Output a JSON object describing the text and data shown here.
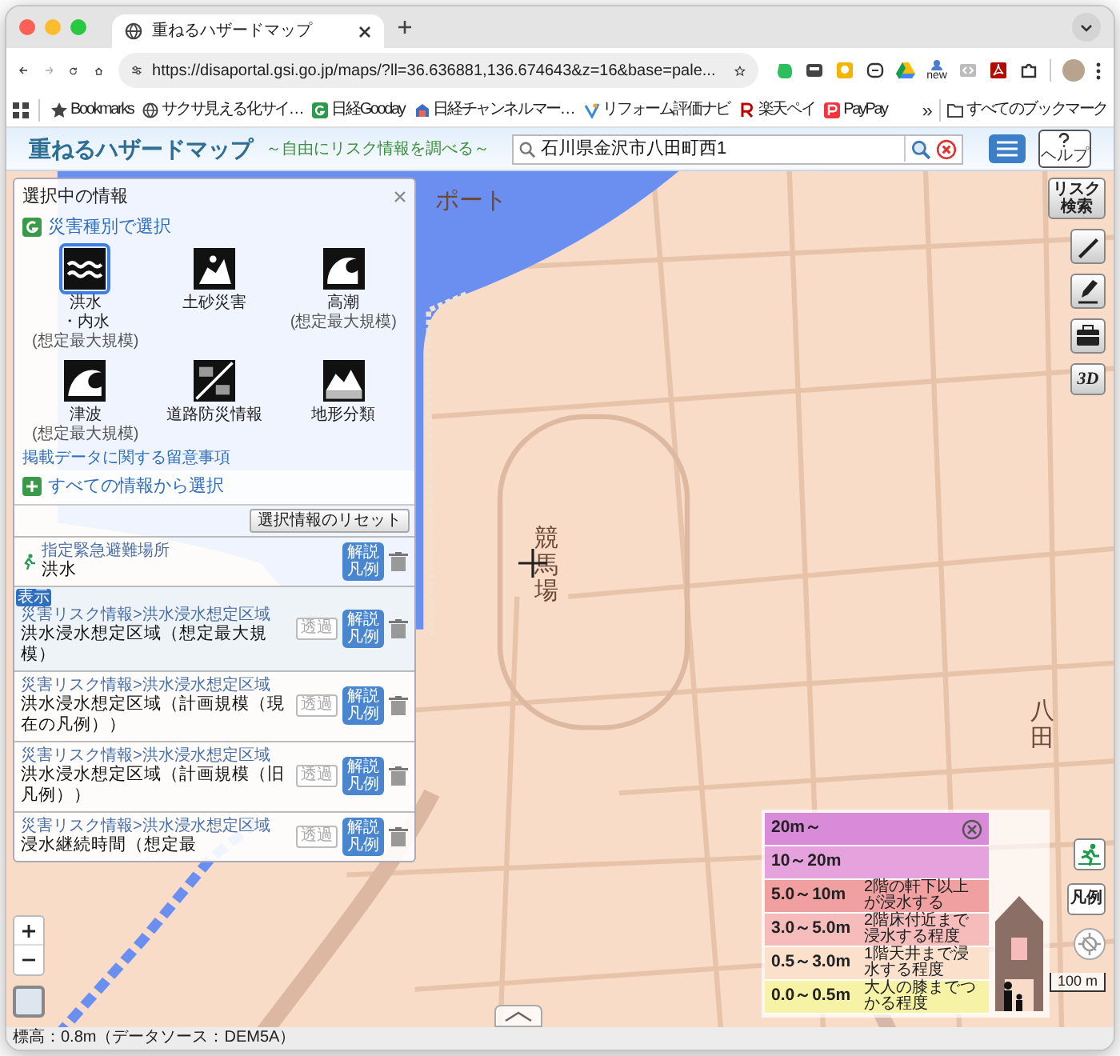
{
  "browser": {
    "tab": {
      "title": "重ねるハザードマップ"
    },
    "url": "https://disaportal.gsi.go.jp/maps/?ll=36.636881,136.674643&z=16&base=pale...",
    "extension_badge": "new",
    "bookmarks": [
      {
        "kind": "star",
        "label": "Bookmarks"
      },
      {
        "kind": "globe",
        "label": "サクサ見える化サイ…"
      },
      {
        "kind": "gooday",
        "label": "日経Gooday"
      },
      {
        "kind": "channel",
        "label": "日経チャンネルマー…"
      },
      {
        "kind": "reform",
        "label": "リフォーム評価ナビ"
      },
      {
        "kind": "rakuten",
        "label": "楽天ペイ"
      },
      {
        "kind": "paypay",
        "label": "PayPay"
      }
    ],
    "bookmarks_overflow": "»",
    "all_bookmarks": "すべてのブックマーク"
  },
  "app": {
    "title": "重ねるハザードマップ",
    "subtitle": "～自由にリスク情報を調べる～",
    "search": {
      "value": "石川県金沢市八田町西1"
    },
    "help": "ヘルプ"
  },
  "panel": {
    "title": "選択中の情報",
    "by_disaster": "災害種別で選択",
    "hazards": [
      {
        "kind": "flood",
        "label": "洪水",
        "label_2": "・内水",
        "note": "(想定最大規模)",
        "selected": true
      },
      {
        "kind": "landslide",
        "label": "土砂災害",
        "selected": false
      },
      {
        "kind": "surge",
        "label": "高潮",
        "note": "(想定最大規模)",
        "selected": false
      },
      {
        "kind": "tsunami",
        "label": "津波",
        "note": "(想定最大規模)",
        "selected": false
      },
      {
        "kind": "road",
        "label": "道路防災情報",
        "selected": false
      },
      {
        "kind": "terrain",
        "label": "地形分類",
        "selected": false
      }
    ],
    "notice_link": "掲載データに関する留意事項",
    "all_info": "すべての情報から選択",
    "reset": "選択情報のリセット",
    "layers": [
      {
        "kind": "shelter",
        "category": "指定緊急避難場所",
        "name": "洪水",
        "legend_button": "解説凡例"
      },
      {
        "kind": "area",
        "shown_badge": "表示",
        "category": "災害リスク情報>洪水浸水想定区域",
        "name": "洪水浸水想定区域（想定最大規模）",
        "transparency": "透過",
        "legend_button": "解説凡例"
      },
      {
        "kind": "area",
        "category": "災害リスク情報>洪水浸水想定区域",
        "name": "洪水浸水想定区域（計画規模（現在の凡例））",
        "transparency": "透過",
        "legend_button": "解説凡例"
      },
      {
        "kind": "area",
        "category": "災害リスク情報>洪水浸水想定区域",
        "name": "洪水浸水想定区域（計画規模（旧凡例））",
        "transparency": "透過",
        "legend_button": "解説凡例"
      },
      {
        "kind": "area",
        "category": "災害リスク情報>洪水浸水想定区域",
        "name": "浸水継続時間（想定最",
        "transparency": "透過",
        "legend_button": "解説凡例"
      }
    ]
  },
  "map": {
    "labels": [
      "ポート",
      "競馬場",
      "八田"
    ]
  },
  "legend": {
    "rows": [
      {
        "range": "20m～",
        "color": "#d98ad9"
      },
      {
        "range": "10～20m",
        "color": "#e6a2dc"
      },
      {
        "range": "5.0～10m",
        "color": "#f0a0a0",
        "description": "2階の軒下以上が浸水する"
      },
      {
        "range": "3.0～5.0m",
        "color": "#f6bcbc",
        "description": "2階床付近まで浸水する程度"
      },
      {
        "range": "0.5～3.0m",
        "color": "#fbe0cc",
        "description": "1階天井まで浸水する程度"
      },
      {
        "range": "0.0～0.5m",
        "color": "#f6f2a6",
        "description": "大人の膝までつかる程度"
      }
    ]
  },
  "toolbar": {
    "risk_search": "リスク検索",
    "three_d": "3D",
    "legend_button": "凡例",
    "scale": "100 m"
  },
  "status_bar": "標高：0.8m（データソース：DEM5A）"
}
